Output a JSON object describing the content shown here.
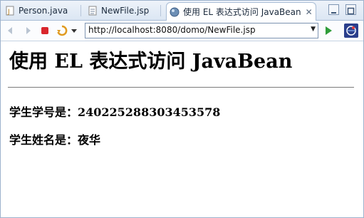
{
  "tabs": [
    {
      "label": "Person.java",
      "icon": "java-file-icon"
    },
    {
      "label": "NewFile.jsp",
      "icon": "jsp-file-icon"
    },
    {
      "label": "使用 EL 表达式访问 JavaBean",
      "icon": "globe-icon"
    }
  ],
  "toolbar": {
    "url": "http://localhost:8080/domo/NewFile.jsp"
  },
  "page": {
    "title": "使用 EL 表达式访问 JavaBean",
    "student_id_line": "学生学号是：240225288303453578",
    "student_name_line": "学生姓名是：夜华"
  },
  "colors": {
    "stop": "#d9262c",
    "go": "#2f9d3a",
    "accent": "#2f6fbf"
  }
}
